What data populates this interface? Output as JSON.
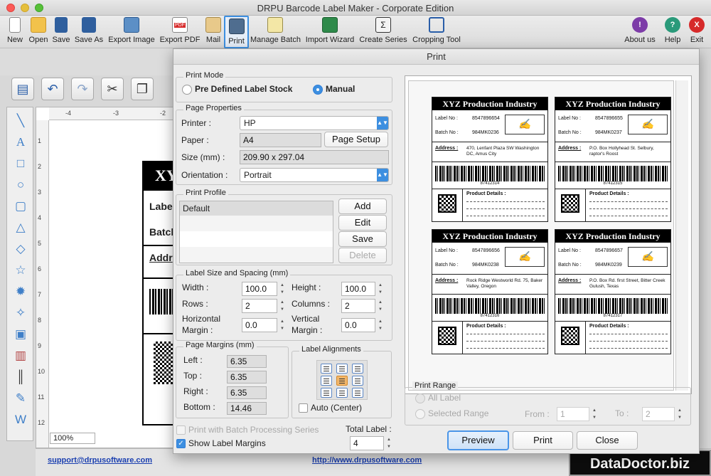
{
  "app": {
    "title": "DRPU Barcode Label Maker - Corporate Edition",
    "toolbar": [
      {
        "name": "new",
        "label": "New",
        "icon": "new-file-icon"
      },
      {
        "name": "open",
        "label": "Open",
        "icon": "open-folder-icon"
      },
      {
        "name": "save",
        "label": "Save",
        "icon": "save-disk-icon"
      },
      {
        "name": "save-as",
        "label": "Save As",
        "icon": "save-as-icon"
      },
      {
        "name": "export-image",
        "label": "Export Image",
        "icon": "export-image-icon"
      },
      {
        "name": "export-pdf",
        "label": "Export PDF",
        "icon": "pdf-icon"
      },
      {
        "name": "mail",
        "label": "Mail",
        "icon": "mail-icon"
      },
      {
        "name": "print",
        "label": "Print",
        "icon": "printer-icon"
      },
      {
        "name": "manage-batch",
        "label": "Manage Batch",
        "icon": "batch-icon"
      },
      {
        "name": "import-wizard",
        "label": "Import Wizard",
        "icon": "excel-icon"
      },
      {
        "name": "create-series",
        "label": "Create Series",
        "icon": "series-icon"
      },
      {
        "name": "cropping-tool",
        "label": "Cropping Tool",
        "icon": "crop-icon"
      },
      {
        "name": "about-us",
        "label": "About us",
        "icon": "about-icon"
      },
      {
        "name": "help",
        "label": "Help",
        "icon": "help-icon"
      },
      {
        "name": "exit",
        "label": "Exit",
        "icon": "exit-icon"
      }
    ],
    "zoom": "100%",
    "support_email": "support@drpusoftware.com",
    "website": "http://www.drpusoftware.com",
    "brand": "DataDoctor.biz",
    "ruler_h": [
      "-4",
      "-3",
      "-2"
    ],
    "ruler_v": [
      "1",
      "2",
      "3",
      "4",
      "5",
      "6",
      "7",
      "8",
      "9",
      "10",
      "11",
      "12"
    ],
    "canvas_label": {
      "head": "XY",
      "label": "Labe",
      "batch": "Batch",
      "address": "Addr"
    }
  },
  "dialog": {
    "title": "Print",
    "print_mode": {
      "title": "Print Mode",
      "option_predefined": "Pre Defined Label Stock",
      "option_manual": "Manual",
      "selected": "manual"
    },
    "page_properties": {
      "title": "Page Properties",
      "printer_label": "Printer :",
      "printer_value": "HP",
      "paper_label": "Paper :",
      "paper_value": "A4",
      "page_setup": "Page Setup",
      "size_label": "Size (mm) :",
      "size_value": "209.90 x 297.04",
      "orientation_label": "Orientation :",
      "orientation_value": "Portrait"
    },
    "print_profile": {
      "title": "Print Profile",
      "items": [
        "Default"
      ],
      "add": "Add",
      "edit": "Edit",
      "save": "Save",
      "delete": "Delete"
    },
    "label_size": {
      "title": "Label Size and Spacing (mm)",
      "width_label": "Width :",
      "width_value": "100.0",
      "height_label": "Height :",
      "height_value": "100.0",
      "rows_label": "Rows :",
      "rows_value": "2",
      "columns_label": "Columns :",
      "columns_value": "2",
      "hmargin_label_1": "Horizontal",
      "hmargin_label_2": "Margin :",
      "hmargin_value": "0.0",
      "vmargin_label_1": "Vertical",
      "vmargin_label_2": "Margin :",
      "vmargin_value": "0.0"
    },
    "page_margins": {
      "title": "Page Margins (mm)",
      "left_label": "Left :",
      "left_value": "6.35",
      "top_label": "Top :",
      "top_value": "6.35",
      "right_label": "Right :",
      "right_value": "6.35",
      "bottom_label": "Bottom :",
      "bottom_value": "14.46"
    },
    "label_alignments": {
      "title": "Label Alignments",
      "auto_center": "Auto (Center)",
      "selected_index": 4
    },
    "batch_processing": "Print with Batch Processing Series",
    "show_margins": "Show Label Margins",
    "total_label_title": "Total Label :",
    "total_label_value": "4",
    "print_range": {
      "title": "Print Range",
      "all_label": "All Label",
      "selected_range": "Selected Range",
      "from_label": "From :",
      "from_value": "1",
      "to_label": "To :",
      "to_value": "2"
    },
    "buttons": {
      "preview": "Preview",
      "print": "Print",
      "close": "Close"
    },
    "preview_labels": [
      {
        "title": "XYZ Production Industry",
        "label_no_t": "Label No :",
        "label_no": "8547896654",
        "batch_no_t": "Batch No :",
        "batch_no": "984MK0236",
        "address_t": "Address :",
        "address": "470, Lenfant Plaza SW Washington DC, Amus City",
        "barcode": "87412314",
        "product_t": "Product Details :"
      },
      {
        "title": "XYZ Production Industry",
        "label_no_t": "Label No :",
        "label_no": "8547896655",
        "batch_no_t": "Batch No :",
        "batch_no": "984MK0237",
        "address_t": "Address :",
        "address": "P.O. Box Hollyhead St. Selbury, raptor's Roost",
        "barcode": "87412315",
        "product_t": "Product Details :"
      },
      {
        "title": "XYZ Production Industry",
        "label_no_t": "Label No :",
        "label_no": "8547896656",
        "batch_no_t": "Batch No :",
        "batch_no": "984MK0238",
        "address_t": "Address :",
        "address": "Rock Ridge Westworld Rd. 75, Baker Valley, Oregon",
        "barcode": "87412316",
        "product_t": "Product Details :"
      },
      {
        "title": "XYZ Production Industry",
        "label_no_t": "Label No :",
        "label_no": "8547896657",
        "batch_no_t": "Batch No :",
        "batch_no": "984MK0239",
        "address_t": "Address :",
        "address": "P.O. Box Rd. first Street, Bitter Creek Gulush, Texas",
        "barcode": "87412317",
        "product_t": "Product Details :"
      }
    ]
  }
}
